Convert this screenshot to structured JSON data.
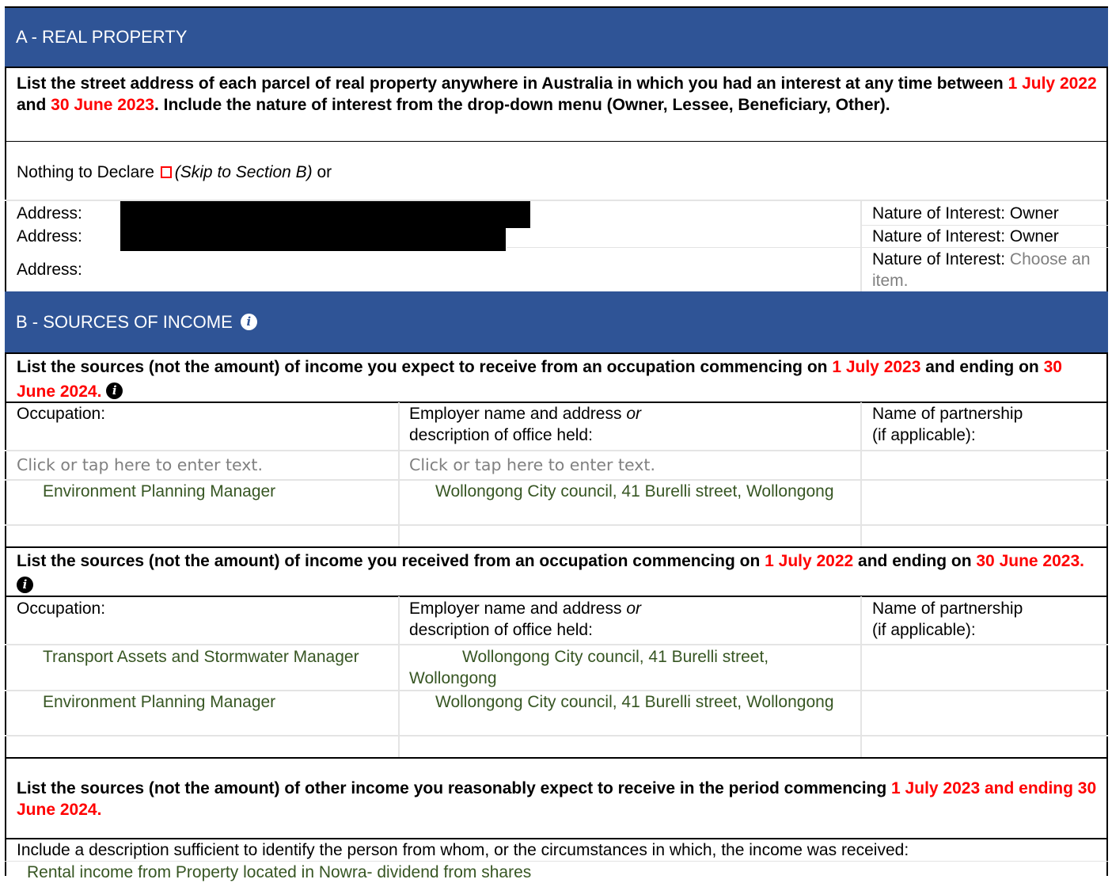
{
  "section_a": {
    "title": "A - REAL PROPERTY",
    "instruction": {
      "p1": "List the street address of each parcel of real property anywhere in Australia in which you had an interest at any time between ",
      "d1": "1 July 2022",
      "p2": " and ",
      "d2": "30 June 2023",
      "p3": ". Include the nature of interest from the drop-down menu (Owner, Lessee, Beneficiary, Other)."
    },
    "nothing_to_declare": {
      "label": "Nothing to Declare ",
      "skip": "(Skip to Section B)",
      "or": " or"
    },
    "addresses": [
      {
        "label": "Address:",
        "interest_label": "Nature of Interest: ",
        "interest_value": "Owner"
      },
      {
        "label": "Address:",
        "interest_label": "Nature of Interest: ",
        "interest_value": "Owner"
      },
      {
        "label": "Address:",
        "interest_label": "Nature of Interest: ",
        "interest_placeholder": "Choose an item."
      }
    ]
  },
  "section_b": {
    "title": "B - SOURCES OF INCOME",
    "expected": {
      "p1": "List the sources (not the amount) of income you expect to receive from an occupation commencing on ",
      "d1": "1 July 2023",
      "p2": " and ending on ",
      "d2": "30 June 2024."
    },
    "received": {
      "p1": "List the sources (not the amount) of income you received from an occupation commencing on ",
      "d1": "1 July 2022",
      "p2": " and ending on ",
      "d2": "30 June 2023."
    },
    "columns": {
      "occupation": "Occupation:",
      "employer_1": "Employer name and address ",
      "employer_or": "or",
      "employer_2": "description of office held:",
      "partnership_1": "Name of partnership",
      "partnership_2": "(if applicable):"
    },
    "placeholder": "Click or tap here to enter text.",
    "expected_rows": [
      {
        "occupation": "Environment Planning Manager",
        "employer": "Wollongong City council, 41 Burelli street, Wollongong"
      }
    ],
    "received_rows": [
      {
        "occupation": "Transport Assets and Stormwater Manager",
        "employer": "Wollongong City council, 41 Burelli street, Wollongong"
      },
      {
        "occupation": "Environment Planning Manager",
        "employer": "Wollongong City council, 41 Burelli street, Wollongong"
      }
    ],
    "other_income": {
      "p1": "List the sources (not the amount) of other income you reasonably expect to receive in the period commencing ",
      "d1": "1 July 2023 and ending 30 June 2024."
    },
    "description_instruction": "Include a description sufficient to identify the person from whom, or the circumstances in which, the income was received:",
    "description_value": "Rental income from Property located in Nowra- dividend from shares"
  }
}
